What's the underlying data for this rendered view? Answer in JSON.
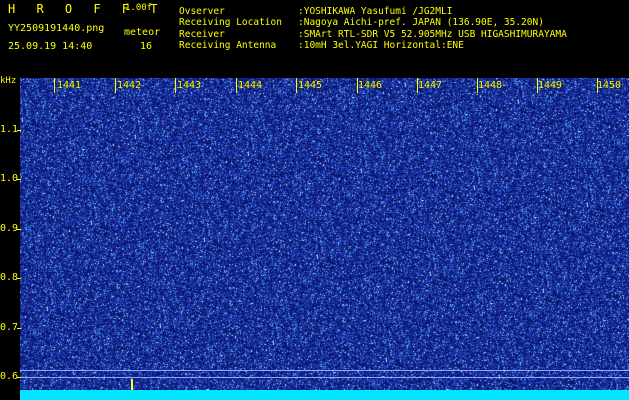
{
  "header": {
    "title": "H R O F F T",
    "version": "1.00f",
    "filename": "YY2509191440.png",
    "mode": "meteor",
    "datetime": "25.09.19 14:40",
    "count": "16"
  },
  "info": [
    {
      "label": "Ovserver",
      "value": ":YOSHIKAWA Yasufumi /JG2MLI"
    },
    {
      "label": "Receiving Location",
      "value": ":Nagoya Aichi-pref. JAPAN (136.90E, 35.20N)"
    },
    {
      "label": "Receiver",
      "value": ":SMArt RTL-SDR V5 52.905MHz USB HIGASHIMURAYAMA"
    },
    {
      "label": "Receiving Antenna",
      "value": ":10mH 3el.YAGI Horizontal:ENE"
    }
  ],
  "axis": {
    "y_unit": "kHz",
    "y_ticks": [
      "1.1",
      "1.0",
      "0.9",
      "0.8",
      "0.7",
      "0.6"
    ],
    "x_ticks": [
      "1441",
      "1442",
      "1443",
      "1444",
      "1445",
      "1446",
      "1447",
      "1448",
      "1449",
      "1450"
    ]
  },
  "colors": {
    "background": "#000000",
    "text": "#ffff00",
    "spectrogram_base": "#1b2f8c",
    "spectrum_bar": "#00e6ff",
    "guide_line": "#8fa6ff"
  }
}
